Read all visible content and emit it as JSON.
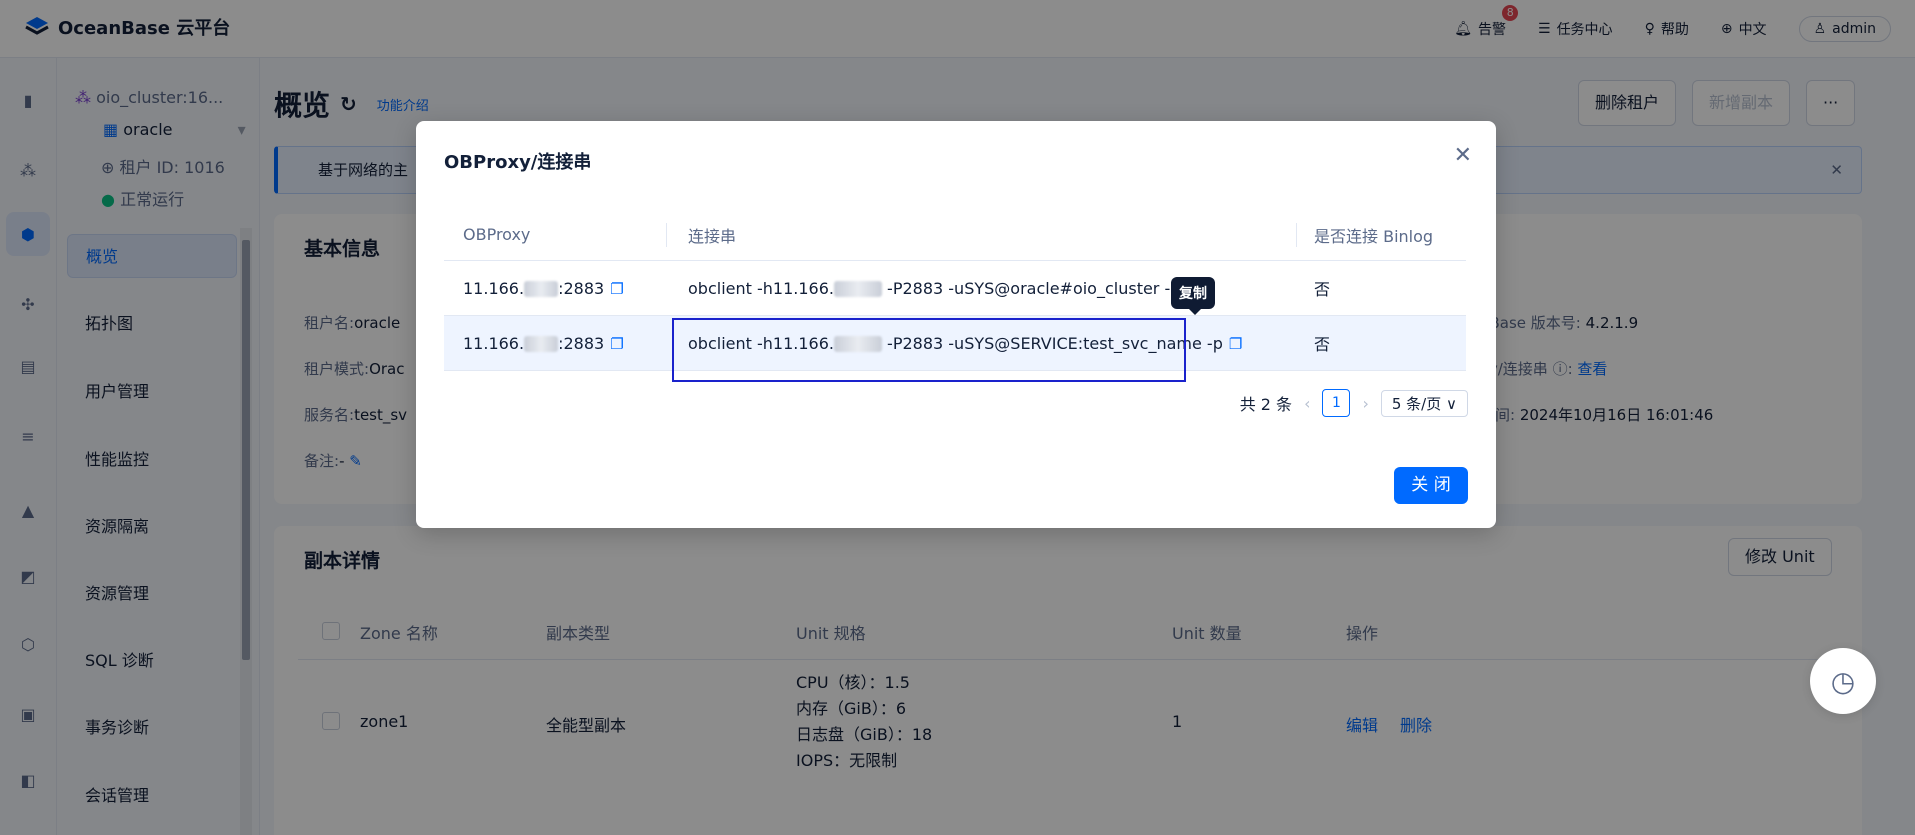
{
  "header": {
    "logo": "OceanBase 云平台",
    "alerts_label": "告警",
    "alerts_count": "8",
    "tasks_label": "任务中心",
    "help_label": "帮助",
    "lang_label": "中文",
    "user": "admin"
  },
  "sidebar": {
    "cluster": "oio_cluster:16...",
    "tenant": "oracle",
    "tenant_id": "租户 ID: 1016",
    "status": "正常运行",
    "items": [
      "概览",
      "拓扑图",
      "用户管理",
      "性能监控",
      "资源隔离",
      "资源管理",
      "SQL 诊断",
      "事务诊断",
      "会话管理"
    ]
  },
  "page": {
    "title": "概览",
    "intro": "功能介绍",
    "delete_tenant": "删除租户",
    "add_replica": "新增副本",
    "more": "···",
    "alert": "基于网络的主",
    "basic_title": "基本信息",
    "basic": {
      "tenant_name_k": "租户名:",
      "tenant_name_v": "oracle",
      "mode_k": "租户模式:",
      "mode_v": "Orac",
      "service_k": "服务名:",
      "service_v": "test_sv",
      "remark_k": "备注:",
      "remark_v": "-",
      "version_k": "nBase 版本号:",
      "version_v": "4.2.1.9",
      "proxy_k": "xy/连接串 ⓘ:",
      "proxy_v": "查看",
      "time_k": "时间:",
      "time_v": "2024年10月16日 16:01:46"
    },
    "replica_title": "副本详情",
    "modify_unit": "修改 Unit",
    "replica_cols": [
      "Zone 名称",
      "副本类型",
      "Unit 规格",
      "Unit 数量",
      "操作"
    ],
    "replica_row": {
      "zone": "zone1",
      "type": "全能型副本",
      "spec": [
        "CPU（核）：1.5",
        "内存（GiB）：6",
        "日志盘（GiB）：18",
        "IOPS：无限制"
      ],
      "count": "1",
      "edit": "编辑",
      "delete": "删除"
    }
  },
  "modal": {
    "title": "OBProxy/连接串",
    "cols": [
      "OBProxy",
      "连接串",
      "是否连接 Binlog"
    ],
    "rows": [
      {
        "proxy_a": "11.166.",
        "proxy_b": ":2883",
        "conn_a": "obclient -h11.166.",
        "conn_b": " -P2883 -uSYS@oracle#oio_cluster -p",
        "binlog": "否"
      },
      {
        "proxy_a": "11.166.",
        "proxy_b": ":2883",
        "conn_a": "obclient -h11.166.",
        "conn_b": " -P2883 -uSYS@SERVICE:test_svc_name -p",
        "binlog": "否"
      }
    ],
    "tooltip": "复制",
    "total": "共 2 条",
    "page": "1",
    "page_size": "5 条/页 ∨",
    "close": "关 闭"
  }
}
